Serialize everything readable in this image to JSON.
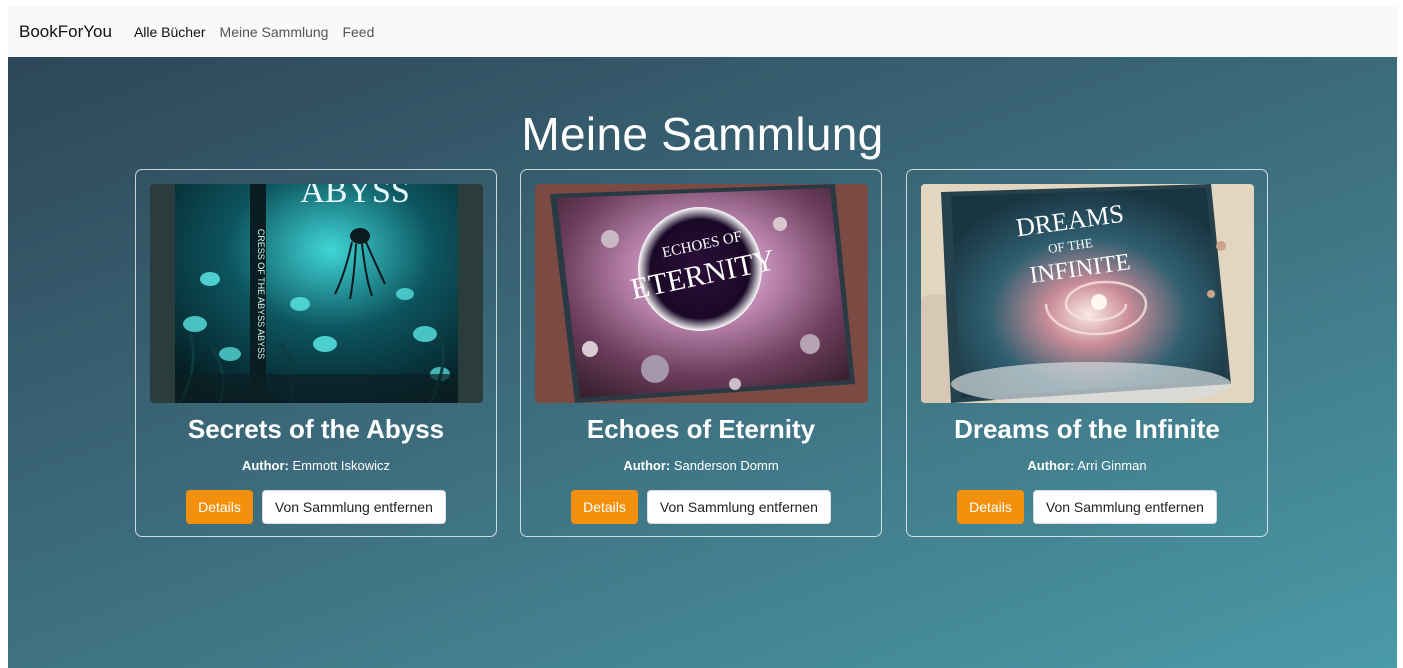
{
  "nav": {
    "brand": "BookForYou",
    "links": [
      {
        "label": "Alle Bücher"
      },
      {
        "label": "Meine Sammlung"
      },
      {
        "label": "Feed"
      }
    ]
  },
  "page": {
    "title": "Meine Sammlung"
  },
  "colors": {
    "accent": "#f5900c",
    "background_start": "#2d4759",
    "background_end": "#4a9aa8"
  },
  "books": [
    {
      "title": "Secrets of the Abyss",
      "author_label": "Author:",
      "author": "Emmott Iskowicz",
      "details_label": "Details",
      "remove_label": "Von Sammlung entfernen",
      "cover_text": "ABYSS",
      "cover_spine_text": "CRESS OF THE ABYSS ABYSS"
    },
    {
      "title": "Echoes of Eternity",
      "author_label": "Author:",
      "author": "Sanderson Domm",
      "details_label": "Details",
      "remove_label": "Von Sammlung entfernen",
      "cover_text_1": "ECHOES OF",
      "cover_text_2": "ETERNITY"
    },
    {
      "title": "Dreams of the Infinite",
      "author_label": "Author:",
      "author": "Arri Ginman",
      "details_label": "Details",
      "remove_label": "Von Sammlung entfernen",
      "cover_text_1": "DREAMS",
      "cover_text_2": "OF THE",
      "cover_text_3": "INFINITE"
    }
  ]
}
